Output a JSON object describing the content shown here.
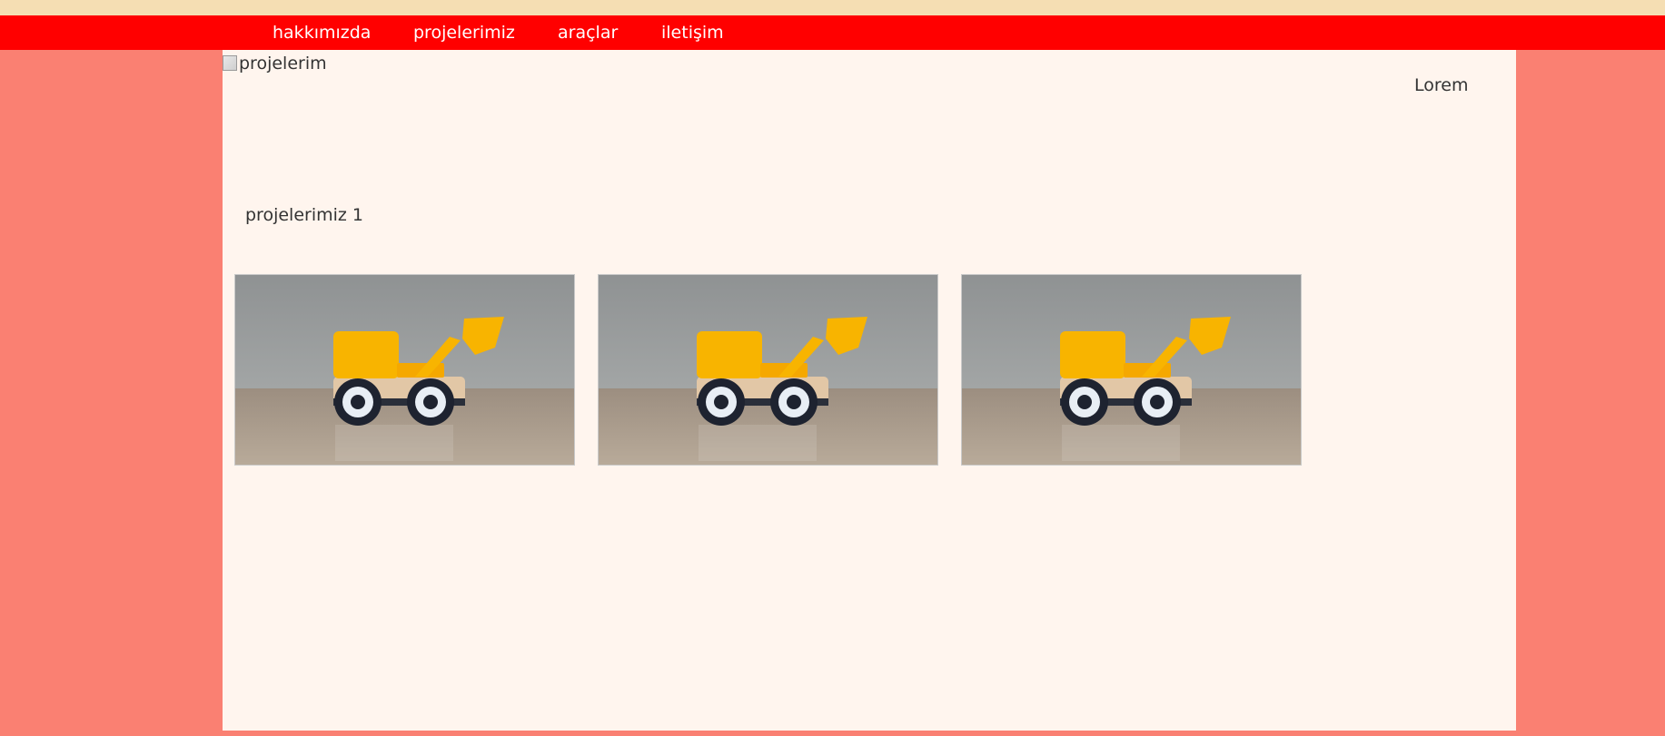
{
  "nav": {
    "items": [
      {
        "label": "hakkımızda"
      },
      {
        "label": "projelerimiz"
      },
      {
        "label": "araçlar"
      },
      {
        "label": "iletişim"
      }
    ]
  },
  "header_image": {
    "alt": "projelerim"
  },
  "side_text": "Lorem",
  "section": {
    "title": "projelerimiz 1"
  },
  "gallery": {
    "images": [
      {
        "subject": "toy bulldozer photo"
      },
      {
        "subject": "toy bulldozer photo"
      },
      {
        "subject": "toy bulldozer photo"
      }
    ]
  },
  "colors": {
    "page_background": "#fa8072",
    "top_strip": "#f5deb3",
    "navbar": "#ff0000",
    "content_background": "#fff5ee",
    "toy_yellow": "#f8b400"
  }
}
